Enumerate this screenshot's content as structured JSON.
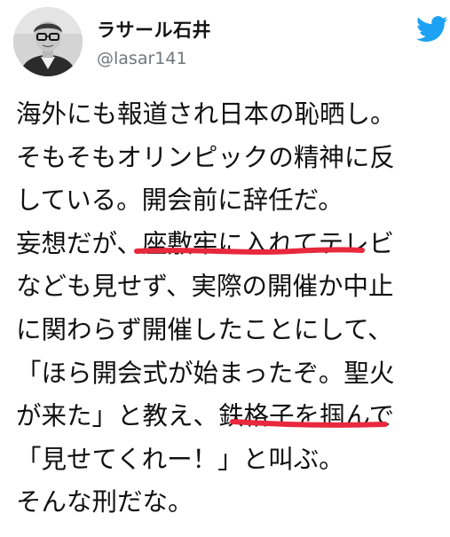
{
  "author": {
    "display_name": "ラサール石井",
    "handle": "@lasar141"
  },
  "tweet": {
    "lines": [
      "海外にも報道され日本の恥晒し。",
      "そもそもオリンピックの精神に反",
      "している。開会前に辞任だ。",
      "妄想だが、座敷牢に入れてテレビ",
      "なども見せず、実際の開催か中止",
      "に関わらず開催したことにして、",
      "「ほら開会式が始まったぞ。聖火",
      "が来た」と教え、鉄格子を掴んで",
      "「見せてくれー！」と叫ぶ。",
      "そんな刑だな。"
    ]
  },
  "icons": {
    "brand": "twitter-bird-icon",
    "avatar": "user-avatar-photo"
  },
  "colors": {
    "brand": "#1da1f2",
    "handle": "#6e767d",
    "text": "#111111",
    "annotation": "#e8283c"
  }
}
